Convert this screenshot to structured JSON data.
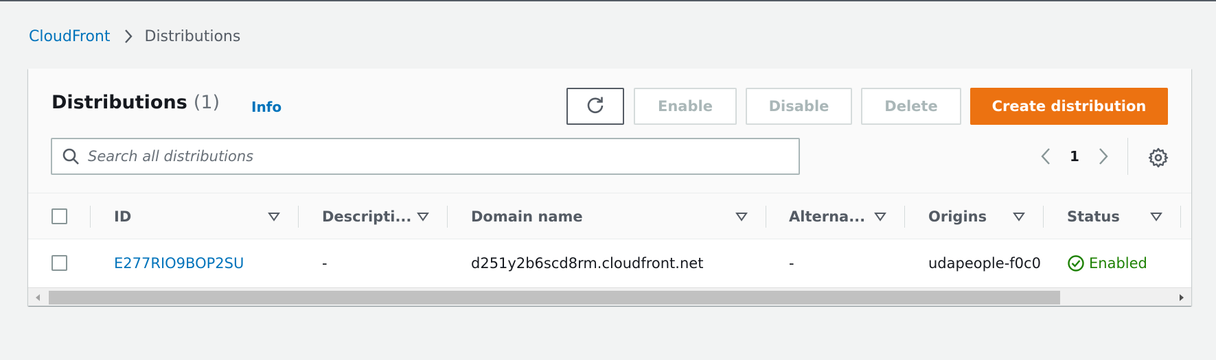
{
  "breadcrumb": {
    "root": "CloudFront",
    "current": "Distributions"
  },
  "panel": {
    "title": "Distributions",
    "count": "(1)",
    "info_label": "Info"
  },
  "toolbar": {
    "refresh_icon": "refresh-icon",
    "enable_label": "Enable",
    "disable_label": "Disable",
    "delete_label": "Delete",
    "create_label": "Create distribution"
  },
  "search": {
    "placeholder": "Search all distributions"
  },
  "pagination": {
    "current_page": "1"
  },
  "table": {
    "columns": [
      "ID",
      "Descripti...",
      "Domain name",
      "Alterna...",
      "Origins",
      "Status"
    ],
    "rows": [
      {
        "id": "E277RIO9BOP2SU",
        "description": "-",
        "domain": "d251y2b6scd8rm.cloudfront.net",
        "alternate": "-",
        "origins": "udapeople-f0c0",
        "status": "Enabled"
      }
    ]
  },
  "colors": {
    "primary_button": "#ec7211",
    "link": "#0073bb",
    "status_enabled": "#1d8102"
  }
}
